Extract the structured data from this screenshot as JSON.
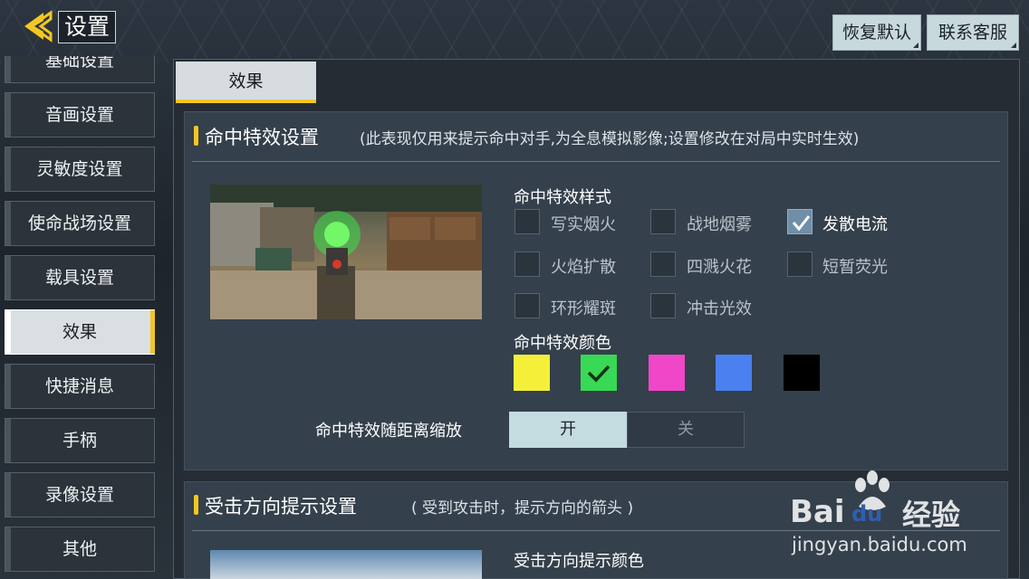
{
  "header": {
    "title": "设置",
    "buttons": {
      "reset": "恢复默认",
      "service": "联系客服"
    }
  },
  "sidebar": {
    "items": [
      {
        "label": "基础设置"
      },
      {
        "label": "音画设置"
      },
      {
        "label": "灵敏度设置"
      },
      {
        "label": "使命战场设置"
      },
      {
        "label": "载具设置"
      },
      {
        "label": "效果",
        "active": true
      },
      {
        "label": "快捷消息"
      },
      {
        "label": "手柄"
      },
      {
        "label": "录像设置"
      },
      {
        "label": "其他"
      }
    ]
  },
  "main": {
    "tab": "效果",
    "section1": {
      "title": "命中特效设置",
      "note": "(此表现仅用来提示命中对手,为全息模拟影像;设置修改在对局中实时生效)",
      "style_label": "命中特效样式",
      "options": [
        {
          "label": "写实烟火",
          "checked": false
        },
        {
          "label": "战地烟雾",
          "checked": false
        },
        {
          "label": "发散电流",
          "checked": true
        },
        {
          "label": "火焰扩散",
          "checked": false
        },
        {
          "label": "四溅火花",
          "checked": false
        },
        {
          "label": "短暂荧光",
          "checked": false
        },
        {
          "label": "环形耀斑",
          "checked": false
        },
        {
          "label": "冲击光效",
          "checked": false
        }
      ],
      "color_label": "命中特效颜色",
      "colors": [
        {
          "hex": "#f4f03a",
          "selected": false
        },
        {
          "hex": "#38d954",
          "selected": true
        },
        {
          "hex": "#f046c8",
          "selected": false
        },
        {
          "hex": "#4a80f0",
          "selected": false
        },
        {
          "hex": "#000000",
          "selected": false
        }
      ],
      "scale_label": "命中特效随距离缩放",
      "toggle": {
        "on": "开",
        "off": "关",
        "value": "on"
      }
    },
    "section2": {
      "title": "受击方向提示设置",
      "note": "( 受到攻击时，提示方向的箭头 )",
      "color_label": "受击方向提示颜色"
    }
  },
  "watermark": {
    "brand": "Bai",
    "brand2": "du",
    "brand3": "经验",
    "url": "jingyan.baidu.com"
  },
  "colors": {
    "accent": "#f3c623",
    "active_toggle": "#c4dbe0"
  }
}
